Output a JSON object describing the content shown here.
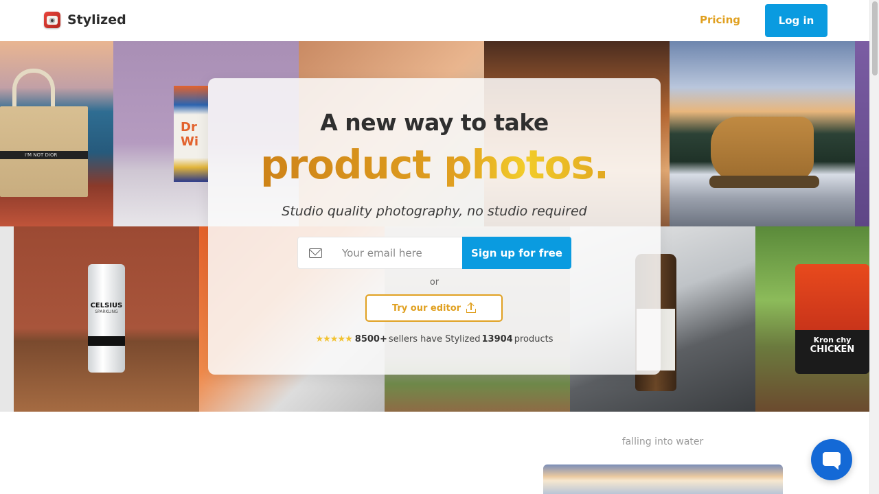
{
  "header": {
    "brand": "Stylized",
    "pricing_label": "Pricing",
    "login_label": "Log in"
  },
  "hero": {
    "headline": "A new way to take",
    "headline_accent": "product photos.",
    "subheadline": "Studio quality photography, no studio required",
    "email_placeholder": "Your email here",
    "signup_label": "Sign up for free",
    "or_label": "or",
    "editor_label": "Try our editor",
    "stars": "★★★★★",
    "sellers_count": "8500+",
    "sellers_text": "sellers have Stylized",
    "products_count": "13904",
    "products_text": "products",
    "gallery_labels": {
      "bag_stripe": "I'M NOT DIOR",
      "can_brand": "CELSIUS",
      "can_variant": "SPARKLING",
      "snack_brand": "Kron chy",
      "snack_flavor": "CHICKEN",
      "box_text": "Dr Wi"
    }
  },
  "below": {
    "caption": "falling into water"
  },
  "colors": {
    "primary": "#0a9be0",
    "accent": "#e0a020",
    "chat": "#1469d6"
  },
  "icons": {
    "logo": "camera-logo-icon",
    "email": "mail-icon",
    "upload": "upload-icon",
    "chat": "chat-bubble-icon"
  }
}
